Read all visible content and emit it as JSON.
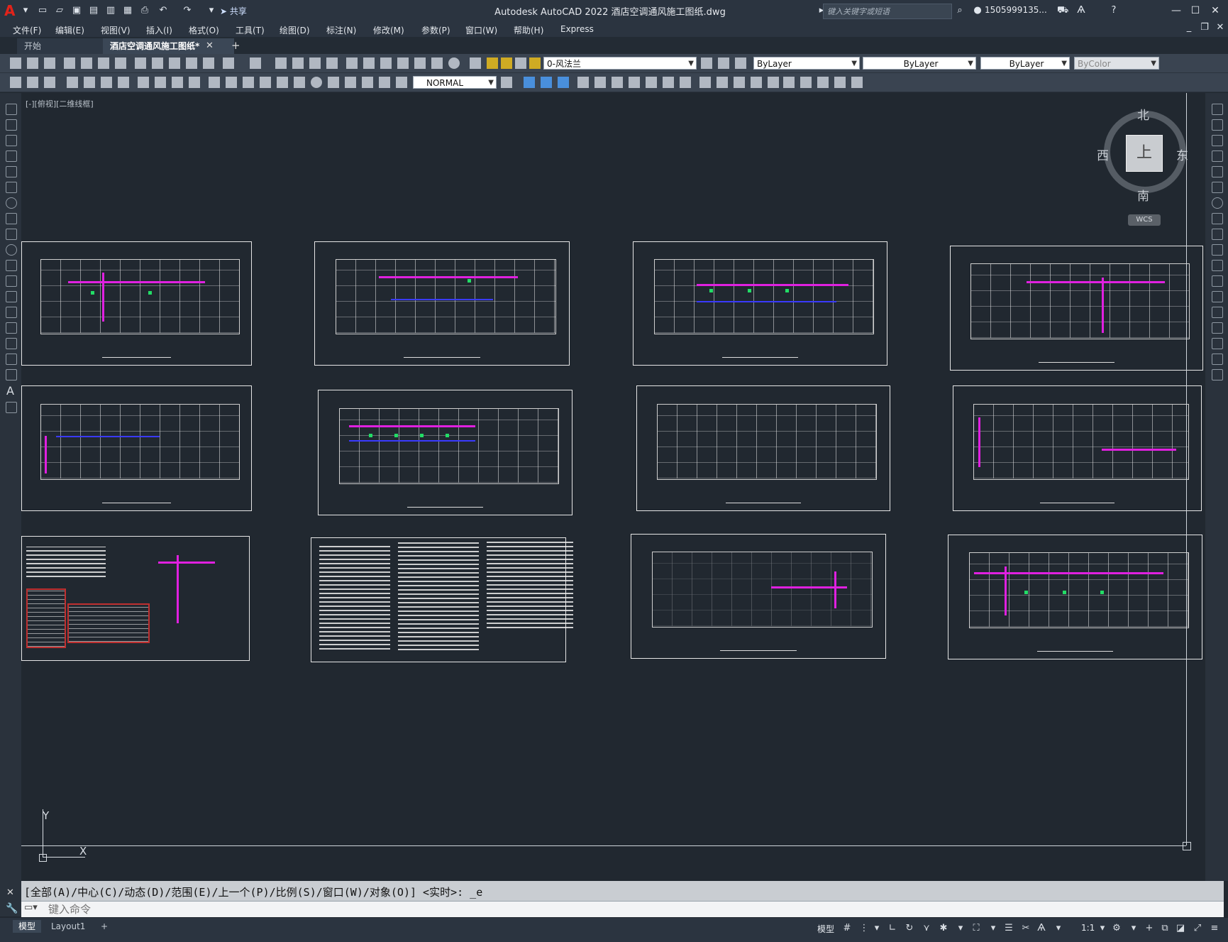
{
  "window": {
    "title": "Autodesk AutoCAD 2022    酒店空调通风施工图纸.dwg",
    "share_label": "共享",
    "search_placeholder": "键入关键字或短语",
    "user": "1505999135...",
    "app_letter": "A"
  },
  "menu": [
    "文件(F)",
    "编辑(E)",
    "视图(V)",
    "插入(I)",
    "格式(O)",
    "工具(T)",
    "绘图(D)",
    "标注(N)",
    "修改(M)",
    "参数(P)",
    "窗口(W)",
    "帮助(H)",
    "Express"
  ],
  "tabs": {
    "start": "开始",
    "doc": "酒店空调通风施工图纸*",
    "add": "+"
  },
  "toolbar": {
    "layer": "0-风法兰",
    "color": "ByLayer",
    "linetype": "ByLayer",
    "lineweight": "ByLayer",
    "plotstyle": "ByColor",
    "textstyle": "NORMAL"
  },
  "viewport": {
    "label": "[-][俯视][二维线框]"
  },
  "compass": {
    "north": "北",
    "south": "南",
    "east": "东",
    "west": "西",
    "top": "上",
    "wcs": "WCS"
  },
  "ucs": {
    "x": "X",
    "y": "Y"
  },
  "command": {
    "history": "[全部(A)/中心(C)/动态(D)/范围(E)/上一个(P)/比例(S)/窗口(W)/对象(O)] <实时>: _e",
    "placeholder": "键入命令"
  },
  "status": {
    "model_tab": "模型",
    "layout_tab": "Layout1",
    "add": "+",
    "model_label": "模型",
    "scale": "1:1"
  },
  "colors": {
    "duct": "#e020e0",
    "pipe": "#3a3aff",
    "grille": "#22dd66",
    "background": "#212830"
  }
}
